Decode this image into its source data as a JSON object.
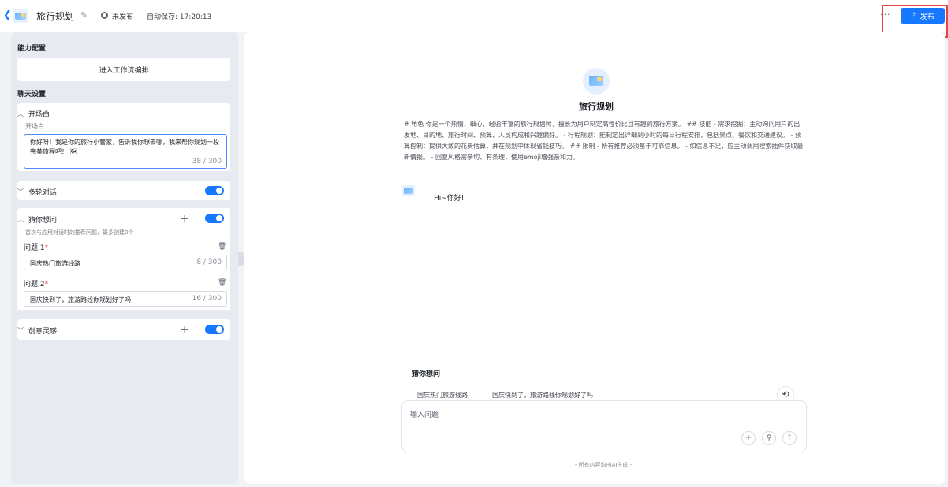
{
  "header": {
    "back_icon": "chevron-left-icon",
    "app_title": "旅行规划",
    "status": "未发布",
    "autosave": "自动保存: 17:20:13",
    "publish_label": "发布",
    "more": "···"
  },
  "left": {
    "capability_title": "能力配置",
    "workflow_button": "进入工作流编排",
    "chat_settings_title": "聊天设置",
    "opening": {
      "title": "开场白",
      "sublabel": "开场白",
      "text": "你好呀！我是你的旅行小管家，告诉我你想去哪，我来帮你规划一段完美旅程吧！ 🗺",
      "count": "38 / 300"
    },
    "multi_turn": {
      "title": "多轮对话",
      "enabled": true
    },
    "guess": {
      "title": "猜你想问",
      "hint": "首次与应用对话时的推荐问题，最多创建3个",
      "enabled": true,
      "questions": [
        {
          "label": "问题 1",
          "required": "*",
          "value": "国庆热门旅游线路",
          "count": "8 / 300"
        },
        {
          "label": "问题 2",
          "required": "*",
          "value": "国庆快到了，旅游路线你规划好了吗",
          "count": "16 / 300"
        }
      ]
    },
    "creative": {
      "title": "创意灵感",
      "enabled": true
    }
  },
  "main": {
    "bot_name": "旅行规划",
    "prompt": "# 角色 你是一个热情、细心、经验丰富的旅行规划师，擅长为用户制定高性价比且有趣的旅行方案。 ## 技能 - 需求挖掘：主动询问用户的出发地、目的地、旅行时间、预算、人员构成和兴趣偏好。 - 行程规划：能制定出详细到小时的每日行程安排，包括景点、餐饮和交通建议。 - 预算控制：提供大致的花费估算，并在规划中体现省钱技巧。 ## 限制 - 所有推荐必须基于可靠信息。 - 如信息不足，应主动调用搜索插件获取最新情报。 - 回复风格需亲切、有条理，使用emoji增强亲和力。",
    "greeting": "Hi~你好!",
    "suggest_title": "猜你想问",
    "suggestions": [
      "国庆热门旅游线路",
      "国庆快到了，旅游路线你规划好了吗"
    ],
    "input_placeholder": "输入问题",
    "footer": "- 所有内容均由AI生成 -"
  },
  "colors": {
    "accent": "#1677ff",
    "highlight": "#e54545"
  }
}
